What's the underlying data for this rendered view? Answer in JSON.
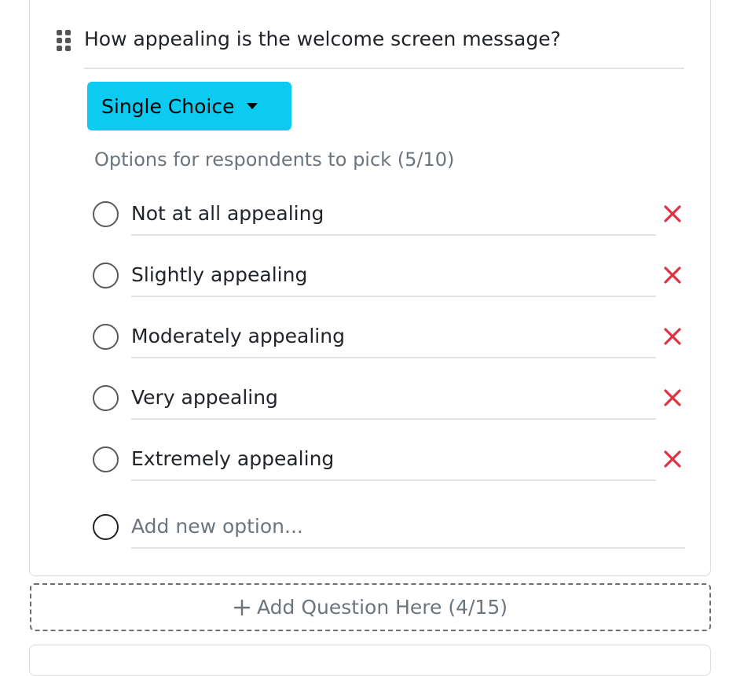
{
  "question": {
    "title": "How appealing is the welcome screen message?",
    "drag_icon": "grip-vertical-icon"
  },
  "type_dropdown": {
    "label": "Single Choice",
    "icon": "caret-down-icon",
    "color": "#0dcaf0"
  },
  "options_hint": "Options for respondents to pick (5/10)",
  "options": [
    {
      "label": "Not at all appealing"
    },
    {
      "label": "Slightly appealing"
    },
    {
      "label": "Moderately appealing"
    },
    {
      "label": "Very appealing"
    },
    {
      "label": "Extremely appealing"
    }
  ],
  "remove_icon": "close-icon",
  "remove_color": "#dc3545",
  "new_option": {
    "placeholder": "Add new option..."
  },
  "add_question": {
    "label": "Add Question Here (4/15)",
    "icon": "plus-icon"
  }
}
